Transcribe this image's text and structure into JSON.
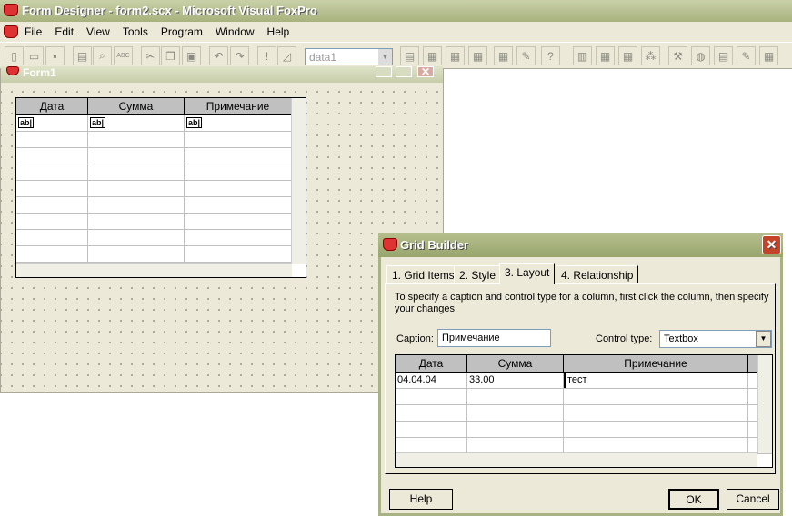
{
  "window": {
    "title": "Form Designer - form2.scx - Microsoft Visual FoxPro"
  },
  "menu": [
    "File",
    "Edit",
    "View",
    "Tools",
    "Program",
    "Window",
    "Help"
  ],
  "toolbar": {
    "combo_value": "data1",
    "spell_label": "ABC"
  },
  "form": {
    "title": "Form1",
    "columns": [
      "Дата",
      "Сумма",
      "Примечание"
    ],
    "cell_control": "ab|"
  },
  "dialog": {
    "title": "Grid Builder",
    "tabs": [
      "1. Grid Items",
      "2. Style",
      "3. Layout",
      "4. Relationship"
    ],
    "active_tab": 2,
    "instructions": "To specify a caption and control type for a column, first click the column, then specify your changes.",
    "caption_label": "Caption:",
    "caption_value": "Примечание",
    "control_type_label": "Control type:",
    "control_type_value": "Textbox",
    "grid": {
      "columns": [
        "Дата",
        "Сумма",
        "Примечание"
      ],
      "rows": [
        [
          "04.04.04",
          "33.00",
          "тест"
        ]
      ]
    },
    "help": "Help",
    "ok": "OK",
    "cancel": "Cancel"
  }
}
